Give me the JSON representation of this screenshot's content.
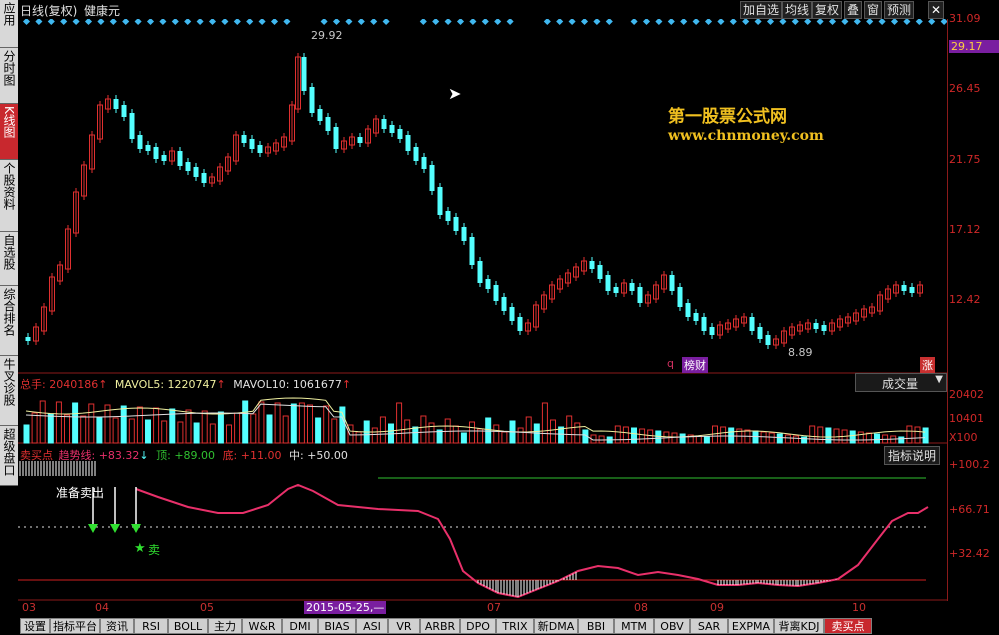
{
  "header": {
    "title": "日线(复权)",
    "stock_name": "健康元",
    "buttons": [
      "加自选",
      "均线",
      "复权",
      "叠",
      "窗",
      "预测"
    ]
  },
  "left_tabs": [
    {
      "label": "应用",
      "active": false
    },
    {
      "label": "分时图",
      "active": false
    },
    {
      "label": "K线图",
      "active": true
    },
    {
      "label": "个股资料",
      "active": false
    },
    {
      "label": "自选股",
      "active": false
    },
    {
      "label": "综合排名",
      "active": false
    },
    {
      "label": "牛叉诊股",
      "active": false
    },
    {
      "label": "超级盘口",
      "active": false
    }
  ],
  "price_axis": {
    "labels": [
      "31.09",
      "26.45",
      "21.75",
      "17.12",
      "12.42"
    ],
    "current": "29.17"
  },
  "annotations": {
    "high": "29.92",
    "low": "8.89",
    "watermark_title": "第一股票公式网",
    "watermark_url": "www.chnmoney.com",
    "badge_q": "q",
    "badge_bangcai": "榜财",
    "badge_zhang": "涨"
  },
  "volume_panel": {
    "total_label": "总手: 2040186",
    "mavol5": "MAVOL5: 1220747",
    "mavol10": "MAVOL10: 1061677",
    "selector": "成交量",
    "axis": [
      "20402",
      "10401",
      "X100"
    ]
  },
  "indicator_panel": {
    "name": "卖买点",
    "trend_label": "趋势线: +83.32",
    "top_label": "顶: +89.00",
    "bottom_label": "底: +11.00",
    "mid_label": "中: +50.00",
    "explain_button": "指标说明",
    "axis": [
      "+100.2",
      "+66.71",
      "+32.42"
    ],
    "text_prepare": "准备卖出",
    "text_sell": "卖"
  },
  "x_axis": {
    "months": [
      "03",
      "04",
      "05",
      "07",
      "08",
      "09",
      "10"
    ],
    "highlight_date": "2015-05-25,—"
  },
  "bottom_tabs": [
    {
      "label": "设置",
      "active": false
    },
    {
      "label": "指标平台",
      "active": false
    },
    {
      "label": "资讯",
      "active": false
    },
    {
      "label": "RSI",
      "active": false
    },
    {
      "label": "BOLL",
      "active": false
    },
    {
      "label": "主力",
      "active": false
    },
    {
      "label": "W&R",
      "active": false
    },
    {
      "label": "DMI",
      "active": false
    },
    {
      "label": "BIAS",
      "active": false
    },
    {
      "label": "ASI",
      "active": false
    },
    {
      "label": "VR",
      "active": false
    },
    {
      "label": "ARBR",
      "active": false
    },
    {
      "label": "DPO",
      "active": false
    },
    {
      "label": "TRIX",
      "active": false
    },
    {
      "label": "新DMA",
      "active": false
    },
    {
      "label": "BBI",
      "active": false
    },
    {
      "label": "MTM",
      "active": false
    },
    {
      "label": "OBV",
      "active": false
    },
    {
      "label": "SAR",
      "active": false
    },
    {
      "label": "EXPMA",
      "active": false
    },
    {
      "label": "背离KDJ",
      "active": false
    },
    {
      "label": "卖买点",
      "active": true
    }
  ],
  "colors": {
    "up": "#e03030",
    "down": "#54ffff",
    "trend": "#e8306a",
    "topline": "#30c030",
    "bottomline": "#d02020"
  }
}
